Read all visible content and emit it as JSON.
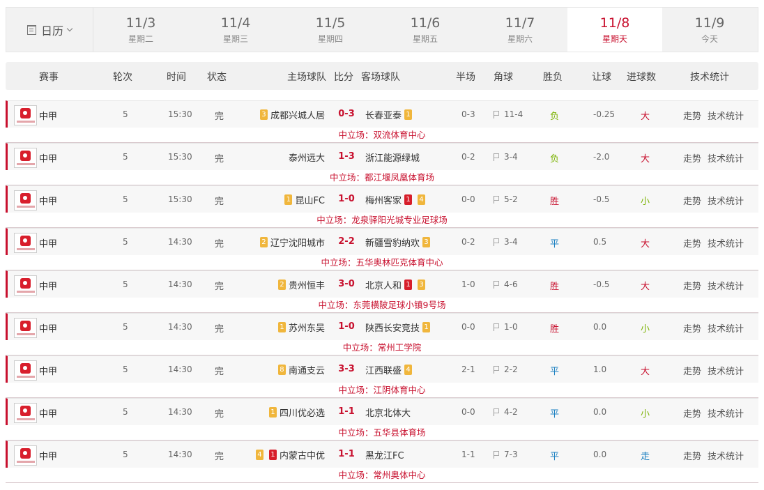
{
  "calendar": {
    "label": "日历"
  },
  "dates": [
    {
      "date": "11/3",
      "weekday": "星期二",
      "active": false
    },
    {
      "date": "11/4",
      "weekday": "星期三",
      "active": false
    },
    {
      "date": "11/5",
      "weekday": "星期四",
      "active": false
    },
    {
      "date": "11/6",
      "weekday": "星期五",
      "active": false
    },
    {
      "date": "11/7",
      "weekday": "星期六",
      "active": false
    },
    {
      "date": "11/8",
      "weekday": "星期天",
      "active": true
    },
    {
      "date": "11/9",
      "weekday": "今天",
      "active": false
    }
  ],
  "columns": {
    "league": "赛事",
    "round": "轮次",
    "time": "时间",
    "state": "状态",
    "home": "主场球队",
    "score": "比分",
    "away": "客场球队",
    "half": "半场",
    "corner": "角球",
    "result": "胜负",
    "handicap": "让球",
    "goals": "进球数",
    "stats": "技术统计"
  },
  "colors": {
    "accent": "#c8102e",
    "win": "#c8102e",
    "lose": "#7cb305",
    "draw": "#1a7fc1",
    "big": "#c8102e",
    "small": "#7cb305",
    "push": "#1a7fc1"
  },
  "links": {
    "trend": "走势",
    "stats": "技术统计"
  },
  "matches": [
    {
      "league": "中甲",
      "round": "5",
      "time": "15:30",
      "state": "完",
      "home": "成都兴城人居",
      "home_badges": [
        {
          "t": "3",
          "c": "y"
        }
      ],
      "score": "0-3",
      "away": "长春亚泰",
      "away_badges": [
        {
          "t": "1",
          "c": "y"
        }
      ],
      "half": "0-3",
      "corner": "11-4",
      "result": "负",
      "handicap": "-0.25",
      "goals": "大",
      "venue": "中立场：双流体育中心"
    },
    {
      "league": "中甲",
      "round": "5",
      "time": "15:30",
      "state": "完",
      "home": "泰州远大",
      "home_badges": [],
      "score": "1-3",
      "away": "浙江能源绿城",
      "away_badges": [],
      "half": "0-2",
      "corner": "3-4",
      "result": "负",
      "handicap": "-2.0",
      "goals": "大",
      "venue": "中立场：都江堰凤凰体育场"
    },
    {
      "league": "中甲",
      "round": "5",
      "time": "15:30",
      "state": "完",
      "home": "昆山FC",
      "home_badges": [
        {
          "t": "1",
          "c": "y"
        }
      ],
      "score": "1-0",
      "away": "梅州客家",
      "away_badges": [
        {
          "t": "1",
          "c": "r"
        },
        {
          "t": "4",
          "c": "y"
        }
      ],
      "half": "0-0",
      "corner": "5-2",
      "result": "胜",
      "handicap": "-0.5",
      "goals": "小",
      "venue": "中立场：龙泉驿阳光城专业足球场"
    },
    {
      "league": "中甲",
      "round": "5",
      "time": "14:30",
      "state": "完",
      "home": "辽宁沈阳城市",
      "home_badges": [
        {
          "t": "2",
          "c": "y"
        }
      ],
      "score": "2-2",
      "away": "新疆雪豹纳欢",
      "away_badges": [
        {
          "t": "3",
          "c": "y"
        }
      ],
      "half": "0-2",
      "corner": "3-4",
      "result": "平",
      "handicap": "0.5",
      "goals": "大",
      "venue": "中立场：五华奥林匹克体育中心"
    },
    {
      "league": "中甲",
      "round": "5",
      "time": "14:30",
      "state": "完",
      "home": "贵州恒丰",
      "home_badges": [
        {
          "t": "2",
          "c": "y"
        }
      ],
      "score": "3-0",
      "away": "北京人和",
      "away_badges": [
        {
          "t": "1",
          "c": "r"
        },
        {
          "t": "3",
          "c": "y"
        }
      ],
      "half": "1-0",
      "corner": "4-6",
      "result": "胜",
      "handicap": "-0.5",
      "goals": "大",
      "venue": "中立场：东莞横陂足球小镇9号场"
    },
    {
      "league": "中甲",
      "round": "5",
      "time": "14:30",
      "state": "完",
      "home": "苏州东吴",
      "home_badges": [
        {
          "t": "1",
          "c": "y"
        }
      ],
      "score": "1-0",
      "away": "陕西长安竞技",
      "away_badges": [
        {
          "t": "1",
          "c": "y"
        }
      ],
      "half": "0-0",
      "corner": "1-0",
      "result": "胜",
      "handicap": "0.0",
      "goals": "小",
      "venue": "中立场：常州工学院"
    },
    {
      "league": "中甲",
      "round": "5",
      "time": "14:30",
      "state": "完",
      "home": "南通支云",
      "home_badges": [
        {
          "t": "8",
          "c": "y"
        }
      ],
      "score": "3-3",
      "away": "江西联盛",
      "away_badges": [
        {
          "t": "4",
          "c": "y"
        }
      ],
      "half": "2-1",
      "corner": "2-2",
      "result": "平",
      "handicap": "1.0",
      "goals": "大",
      "venue": "中立场：江阴体育中心"
    },
    {
      "league": "中甲",
      "round": "5",
      "time": "14:30",
      "state": "完",
      "home": "四川优必选",
      "home_badges": [
        {
          "t": "1",
          "c": "y"
        }
      ],
      "score": "1-1",
      "away": "北京北体大",
      "away_badges": [],
      "half": "0-0",
      "corner": "4-2",
      "result": "平",
      "handicap": "0.0",
      "goals": "小",
      "venue": "中立场：五华县体育场"
    },
    {
      "league": "中甲",
      "round": "5",
      "time": "14:30",
      "state": "完",
      "home": "内蒙古中优",
      "home_badges": [
        {
          "t": "4",
          "c": "y"
        },
        {
          "t": "1",
          "c": "r"
        }
      ],
      "score": "1-1",
      "away": "黑龙江FC",
      "away_badges": [],
      "half": "1-1",
      "corner": "7-3",
      "result": "平",
      "handicap": "0.0",
      "goals": "走",
      "venue": "中立场：常州奥体中心"
    }
  ]
}
